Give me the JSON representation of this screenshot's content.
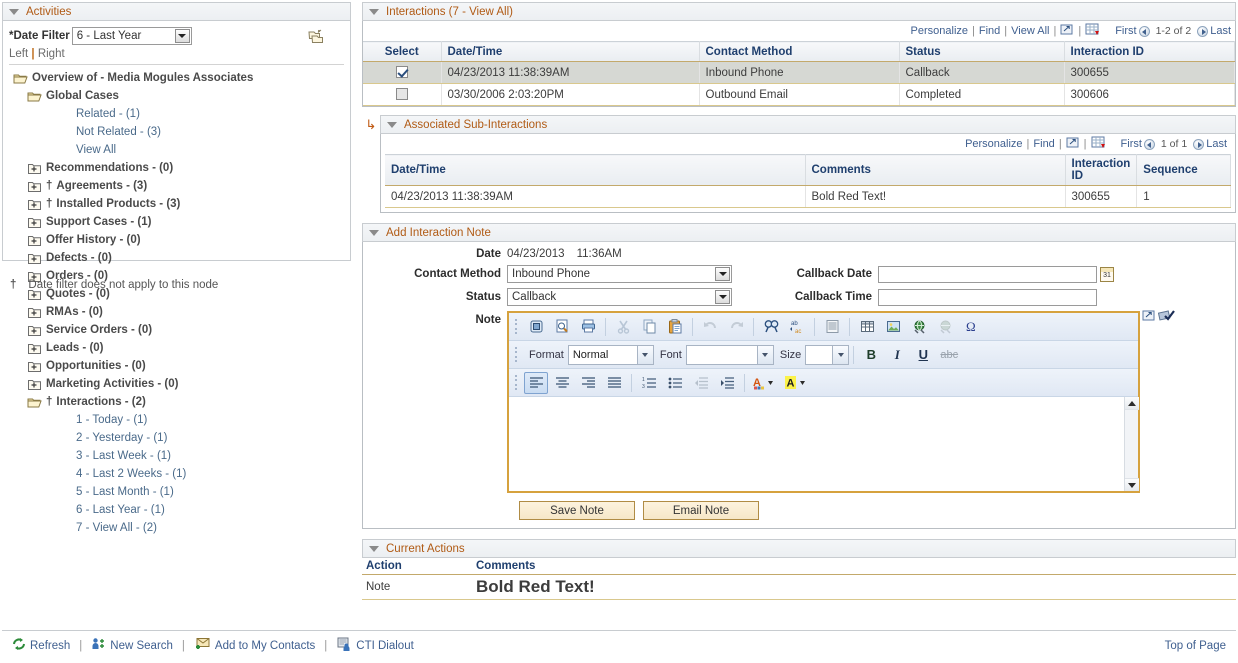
{
  "left_panel": {
    "title": "Activities",
    "date_filter_label": "*Date Filter",
    "date_filter_value": "6 - Last Year",
    "left_link": "Left",
    "right_link": "Right",
    "separator": "|",
    "filter_icon": "folder-filter-icon",
    "tree": [
      {
        "label": "Overview of - Media Mogules Associates",
        "level": 1,
        "icon": "open-folder-icon",
        "style": "bold",
        "dagger": false
      },
      {
        "label": "Global Cases",
        "level": 2,
        "icon": "open-folder-icon",
        "style": "bold",
        "dagger": false
      },
      {
        "label": "Related - (1)",
        "level": 3,
        "icon": "none",
        "style": "link",
        "dagger": false
      },
      {
        "label": "Not Related - (3)",
        "level": 3,
        "icon": "none",
        "style": "link",
        "dagger": false
      },
      {
        "label": "View All",
        "level": 3,
        "icon": "none",
        "style": "link",
        "dagger": false
      },
      {
        "label": "Recommendations - (0)",
        "level": 2,
        "icon": "closed-folder-plus-icon",
        "style": "bold",
        "dagger": false
      },
      {
        "label": "Agreements - (3)",
        "level": 2,
        "icon": "closed-folder-plus-icon",
        "style": "bold",
        "dagger": true
      },
      {
        "label": "Installed Products - (3)",
        "level": 2,
        "icon": "closed-folder-plus-icon",
        "style": "bold",
        "dagger": true
      },
      {
        "label": "Support Cases - (1)",
        "level": 2,
        "icon": "closed-folder-plus-icon",
        "style": "bold",
        "dagger": false
      },
      {
        "label": "Offer History - (0)",
        "level": 2,
        "icon": "closed-folder-plus-icon",
        "style": "bold",
        "dagger": false
      },
      {
        "label": "Defects - (0)",
        "level": 2,
        "icon": "closed-folder-plus-icon",
        "style": "bold",
        "dagger": false
      },
      {
        "label": "Orders - (0)",
        "level": 2,
        "icon": "closed-folder-plus-icon",
        "style": "bold",
        "dagger": false
      },
      {
        "label": "Quotes - (0)",
        "level": 2,
        "icon": "closed-folder-plus-icon",
        "style": "bold",
        "dagger": false
      },
      {
        "label": "RMAs - (0)",
        "level": 2,
        "icon": "closed-folder-plus-icon",
        "style": "bold",
        "dagger": false
      },
      {
        "label": "Service Orders - (0)",
        "level": 2,
        "icon": "closed-folder-plus-icon",
        "style": "bold",
        "dagger": false
      },
      {
        "label": "Leads - (0)",
        "level": 2,
        "icon": "closed-folder-plus-icon",
        "style": "bold",
        "dagger": false
      },
      {
        "label": "Opportunities - (0)",
        "level": 2,
        "icon": "closed-folder-plus-icon",
        "style": "bold",
        "dagger": false
      },
      {
        "label": "Marketing Activities - (0)",
        "level": 2,
        "icon": "closed-folder-plus-icon",
        "style": "bold",
        "dagger": false
      },
      {
        "label": "Interactions - (2)",
        "level": 2,
        "icon": "open-folder-icon",
        "style": "bold",
        "dagger": true
      },
      {
        "label": "1 - Today - (1)",
        "level": 3,
        "icon": "none",
        "style": "link",
        "dagger": false
      },
      {
        "label": "2 - Yesterday - (1)",
        "level": 3,
        "icon": "none",
        "style": "link",
        "dagger": false
      },
      {
        "label": "3 - Last Week - (1)",
        "level": 3,
        "icon": "none",
        "style": "link",
        "dagger": false
      },
      {
        "label": "4 - Last 2 Weeks - (1)",
        "level": 3,
        "icon": "none",
        "style": "link",
        "dagger": false
      },
      {
        "label": "5 - Last Month - (1)",
        "level": 3,
        "icon": "none",
        "style": "link",
        "dagger": false
      },
      {
        "label": "6 - Last Year - (1)",
        "level": 3,
        "icon": "none",
        "style": "link",
        "dagger": false
      },
      {
        "label": "7 - View All - (2)",
        "level": 3,
        "icon": "none",
        "style": "link",
        "dagger": false
      }
    ],
    "footnote_symbol": "†",
    "footnote_text": "Date filter does not apply to this node"
  },
  "interactions": {
    "title": "Interactions (7 - View All)",
    "toolbar": {
      "personalize": "Personalize",
      "find": "Find",
      "view_all": "View All",
      "expand_icon": "open-new-window-icon",
      "grid_icon": "download-to-excel-icon",
      "first": "First",
      "count": "1-2 of 2",
      "last": "Last"
    },
    "columns": [
      "Select",
      "Date/Time",
      "Contact Method",
      "Status",
      "Interaction ID"
    ],
    "rows": [
      {
        "selected": true,
        "datetime": "04/23/2013 11:38:39AM",
        "contact_method": "Inbound Phone",
        "status": "Callback",
        "interaction_id": "300655"
      },
      {
        "selected": false,
        "datetime": "03/30/2006 2:03:20PM",
        "contact_method": "Outbound Email",
        "status": "Completed",
        "interaction_id": "300606"
      }
    ]
  },
  "sub_interactions": {
    "title": "Associated Sub-Interactions",
    "toolbar": {
      "personalize": "Personalize",
      "find": "Find",
      "expand_icon": "open-new-window-icon",
      "grid_icon": "download-to-excel-icon",
      "first": "First",
      "count": "1 of 1",
      "last": "Last"
    },
    "columns": [
      "Date/Time",
      "Comments",
      "Interaction ID",
      "Sequence"
    ],
    "rows": [
      {
        "datetime": "04/23/2013 11:38:39AM",
        "comments": "Bold Red Text!",
        "interaction_id": "300655",
        "sequence": "1"
      }
    ]
  },
  "add_note": {
    "title": "Add Interaction Note",
    "date_label": "Date",
    "date_value": "04/23/2013",
    "time_value": "11:36AM",
    "contact_method_label": "Contact Method",
    "contact_method_value": "Inbound Phone",
    "status_label": "Status",
    "status_value": "Callback",
    "callback_date_label": "Callback Date",
    "callback_date_value": "",
    "callback_time_label": "Callback Time",
    "callback_time_value": "",
    "note_label": "Note",
    "note_value": "",
    "expand_icon": "open-new-window-icon",
    "spellcheck_icon": "spellcheck-icon",
    "editor": {
      "row1_icons": [
        "source-view-icon",
        "preview-icon",
        "print-icon",
        "cut-icon",
        "copy-icon",
        "paste-icon",
        "undo-icon",
        "redo-icon",
        "find-icon",
        "replace-icon",
        "select-all-icon",
        "table-icon",
        "image-icon",
        "link-icon",
        "unlink-icon",
        "special-character-icon"
      ],
      "format_label": "Format",
      "format_value": "Normal",
      "font_label": "Font",
      "font_value": "",
      "size_label": "Size",
      "size_value": "",
      "bold": "B",
      "italic": "I",
      "underline": "U",
      "strikethrough": "abc",
      "row3_icons": [
        "align-left-icon",
        "align-center-icon",
        "align-right-icon",
        "align-justify-icon",
        "numbered-list-icon",
        "bulleted-list-icon",
        "outdent-icon",
        "indent-icon",
        "text-color-icon",
        "background-color-icon"
      ]
    },
    "save_button": "Save Note",
    "email_button": "Email Note"
  },
  "current_actions": {
    "title": "Current Actions",
    "columns": [
      "Action",
      "Comments"
    ],
    "rows": [
      {
        "action": "Note",
        "comments": "Bold Red Text!"
      }
    ]
  },
  "footer": {
    "refresh": "Refresh",
    "new_search": "New Search",
    "add_to_contacts": "Add to My Contacts",
    "cti_dialout": "CTI Dialout",
    "top_of_page": "Top of Page",
    "separator": "|",
    "icons": {
      "refresh": "refresh-icon",
      "new_search": "new-search-icon",
      "add_to_contacts": "add-contact-icon",
      "cti_dialout": "cti-dialout-icon"
    }
  },
  "colors": {
    "section_title": "#b05a14",
    "link": "#3f5f8f",
    "header_text": "#1f3f6e",
    "grid_border": "#d9c88d",
    "selected_row": "#d6d8d3",
    "editor_border": "#d6a23e",
    "button_bg": "#f6e7c8",
    "red_text": "#ee0000"
  }
}
